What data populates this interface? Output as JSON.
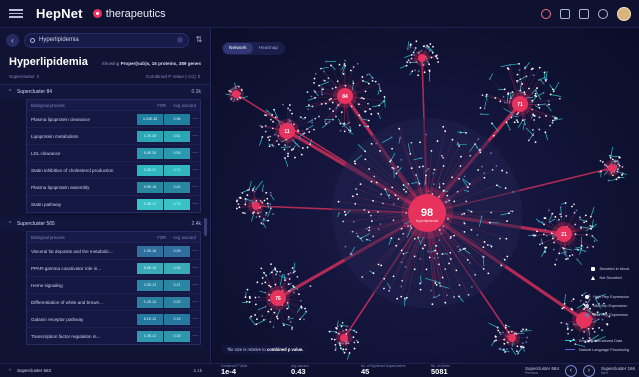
{
  "app": {
    "name": "HepNet",
    "product": "therapeutics"
  },
  "toolbar": {
    "icons": [
      "bell-icon",
      "chat-icon",
      "bookmark-icon",
      "share-icon"
    ]
  },
  "search": {
    "value": "Hyperlipidemia",
    "placeholder": "Search"
  },
  "panel": {
    "title": "Hyperlipidemia",
    "showing_prefix": "Showing",
    "showing_value": "Proper(sub)s, 16 proteins, 389 genes",
    "sort_left": "Supercluster ⇕",
    "sort_right": "Combined P Value (-G1) ⇕"
  },
  "clusters": [
    {
      "name": "Supercluster 84",
      "count": "0.3k",
      "columns": [
        "Biological process",
        "FDR",
        "Avg Jaccard"
      ],
      "rows": [
        {
          "label": "Plasma lipoprotein clearance",
          "fdr": "4.34E-38",
          "jac": "0.96"
        },
        {
          "label": "Lipoprotein metabolism",
          "fdr": "1.2E-35",
          "jac": "0.61"
        },
        {
          "label": "LDL clearance",
          "fdr": "5.0E-30",
          "jac": "0.55"
        },
        {
          "label": "Statin inhibition of cholesterol production",
          "fdr": "2.5E-21",
          "jac": "0.71"
        },
        {
          "label": "Plasma lipoprotein assembly",
          "fdr": "9.9E-18",
          "jac": "0.40"
        },
        {
          "label": "Statin pathway",
          "fdr": "3.3E-17",
          "jac": "0.73"
        }
      ]
    },
    {
      "name": "Supercluster 565",
      "count": "2.4k",
      "columns": [
        "Biological process",
        "FDR",
        "Avg Jaccard"
      ],
      "rows": [
        {
          "label": "Visceral fat deposits and the metabolic...",
          "fdr": "1.0E-16",
          "jac": "0.29"
        },
        {
          "label": "PPAR-gamma coactivator role in...",
          "fdr": "6.6E-15",
          "jac": "0.25"
        },
        {
          "label": "Heme signaling",
          "fdr": "3.0E-13",
          "jac": "0.21"
        },
        {
          "label": "Differentiation of white and brown...",
          "fdr": "1.2E-12",
          "jac": "0.20"
        },
        {
          "label": "Galanin receptor pathway",
          "fdr": "8.1E-12",
          "jac": "0.19"
        },
        {
          "label": "Transcription factor regulation in...",
          "fdr": "1.0E-11",
          "jac": "0.18"
        }
      ]
    }
  ],
  "next_cluster": {
    "name": "Supercluster 563",
    "count": "2.1k"
  },
  "view_tabs": [
    "Network",
    "Heatmap"
  ],
  "network": {
    "center_value": "98",
    "center_label": "Hyperlipidemia",
    "nodes": [
      {
        "value": "84"
      },
      {
        "value": "71"
      },
      {
        "value": "76"
      },
      {
        "value": "11"
      },
      {
        "value": "21"
      }
    ]
  },
  "legend": {
    "shape": [
      {
        "icon": "square",
        "label": "Secreted in blood"
      },
      {
        "icon": "triangle",
        "label": "Not Secreted"
      }
    ],
    "expression": [
      {
        "label": "High Hep Expression",
        "color": "#ffffff"
      },
      {
        "label": "Mid Hep Expression",
        "color": "#c6c9ea"
      },
      {
        "label": "Low Hep Expression",
        "color": "#6c72b3"
      }
    ],
    "edges": [
      {
        "label": "Empirical Structured Data",
        "color": "#27c2c7"
      },
      {
        "label": "Natural Language Processing",
        "color": "#6b57e0"
      }
    ]
  },
  "note": {
    "prefix": "Tile size is relative to",
    "emphasis": "combined p value."
  },
  "stats": [
    {
      "key": "Combined P Value",
      "value": "1e-4"
    },
    {
      "key": "Avg Jaccard",
      "value": "0.43"
    },
    {
      "key": "No. of Significant Superclusters",
      "value": "45"
    },
    {
      "key": "No. of Genes",
      "value": "5081"
    }
  ],
  "pager": {
    "current": "Supercluster 684",
    "sub": "Previous",
    "next": "Supercluster 166",
    "next_sub": "Next"
  },
  "colors": {
    "accent": "#e7325e",
    "teal": "#27c2c7",
    "bg": "#0b0e24"
  }
}
